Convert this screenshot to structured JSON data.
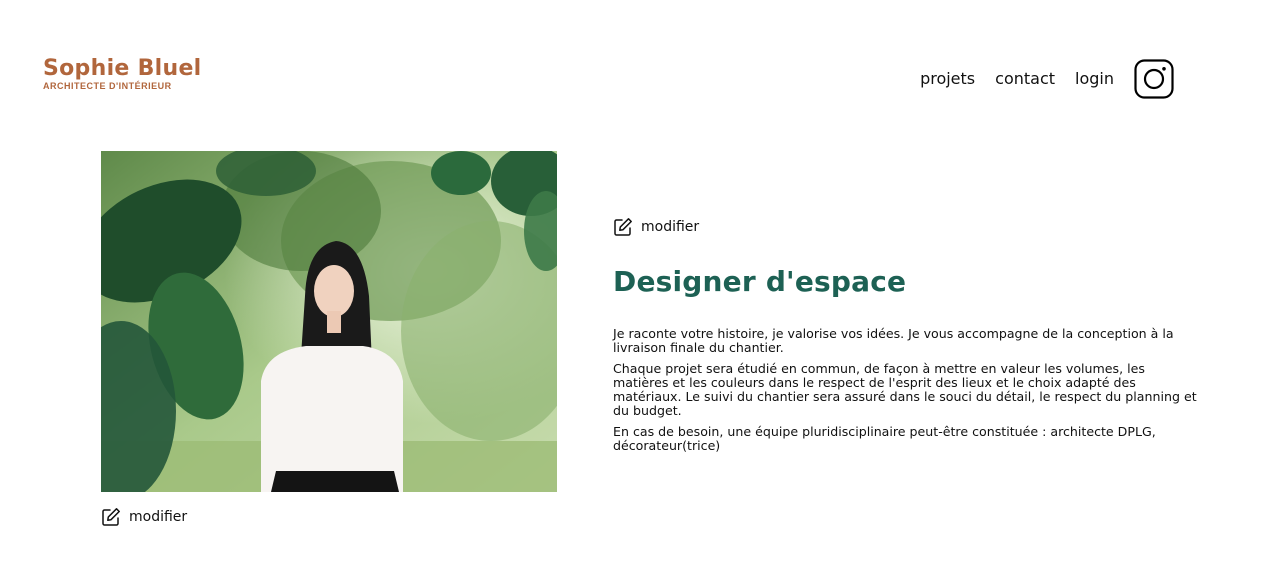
{
  "header": {
    "logo_name": "Sophie Bluel",
    "logo_subtitle": "ARCHITECTE D'INTÉRIEUR",
    "nav": {
      "projects": "projets",
      "contact": "contact",
      "login": "login"
    },
    "instagram_icon": "instagram-icon"
  },
  "introduction": {
    "photo_edit_label": "modifier",
    "text_edit_label": "modifier",
    "title": "Designer d'espace",
    "paragraphs": [
      "Je raconte votre histoire, je valorise vos idées. Je vous accompagne de la conception à la livraison finale du chantier.",
      "Chaque projet sera étudié en commun, de façon à mettre en valeur les volumes, les matières et les couleurs dans le respect de l'esprit des lieux et le choix adapté des matériaux. Le suivi du chantier sera assuré dans le souci du détail, le respect du planning et du budget.",
      "En cas de besoin, une équipe pluridisciplinaire peut-être constituée : architecte DPLG, décorateur(trice)"
    ]
  },
  "colors": {
    "brand": "#B1663C",
    "title": "#1D6154",
    "text": "#111111"
  }
}
